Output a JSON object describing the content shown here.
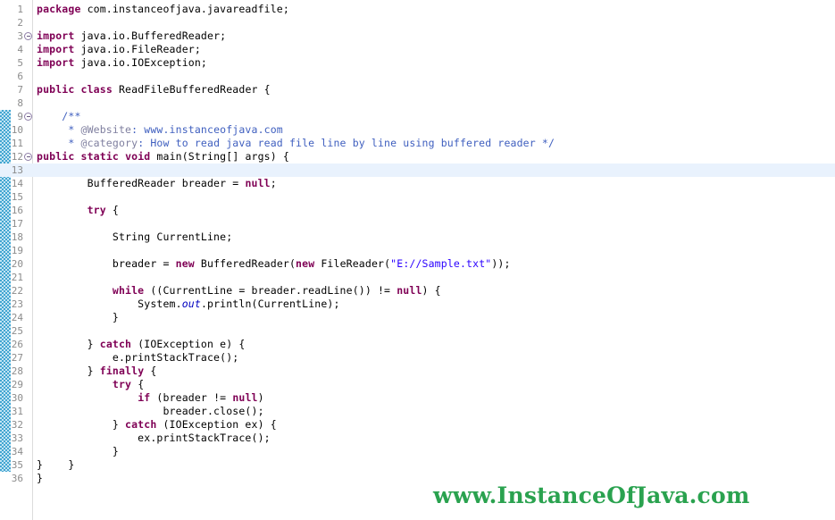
{
  "app": {
    "name": "eclipse-java-editor",
    "file_language": "Java"
  },
  "theme": {
    "background": "#ffffff",
    "line_number_color": "#8c8c8c",
    "current_line_highlight": "#e9f2fd",
    "keyword_color": "#7f0055",
    "string_color": "#2a00ff",
    "javadoc_color": "#3f5fbf",
    "javadoc_tag_color": "#7f7f9f",
    "static_field_color": "#0000c0",
    "change_bar_color": "#2196c9",
    "watermark_color": "#2aa24f"
  },
  "editor": {
    "current_line": 13,
    "change_bar_from_line": 9,
    "change_bar_to_line": 35,
    "fold_markers_on_lines": [
      3,
      9,
      12
    ],
    "lines": [
      {
        "n": 1,
        "tokens": [
          {
            "t": "kw",
            "v": "package"
          },
          {
            "t": "plain",
            "v": " com.instanceofjava.javareadfile;"
          }
        ]
      },
      {
        "n": 2,
        "tokens": []
      },
      {
        "n": 3,
        "tokens": [
          {
            "t": "kw",
            "v": "import"
          },
          {
            "t": "plain",
            "v": " java.io.BufferedReader;"
          }
        ]
      },
      {
        "n": 4,
        "tokens": [
          {
            "t": "kw",
            "v": "import"
          },
          {
            "t": "plain",
            "v": " java.io.FileReader;"
          }
        ]
      },
      {
        "n": 5,
        "tokens": [
          {
            "t": "kw",
            "v": "import"
          },
          {
            "t": "plain",
            "v": " java.io.IOException;"
          }
        ]
      },
      {
        "n": 6,
        "tokens": []
      },
      {
        "n": 7,
        "tokens": [
          {
            "t": "kw",
            "v": "public"
          },
          {
            "t": "plain",
            "v": " "
          },
          {
            "t": "kw",
            "v": "class"
          },
          {
            "t": "plain",
            "v": " ReadFileBufferedReader {"
          }
        ]
      },
      {
        "n": 8,
        "tokens": []
      },
      {
        "n": 9,
        "tokens": [
          {
            "t": "cmt",
            "v": "    /**"
          }
        ]
      },
      {
        "n": 10,
        "tokens": [
          {
            "t": "cmt",
            "v": "     * "
          },
          {
            "t": "cmtt",
            "v": "@Website"
          },
          {
            "t": "cmt",
            "v": ": www.instanceofjava.com"
          }
        ]
      },
      {
        "n": 11,
        "tokens": [
          {
            "t": "cmt",
            "v": "     * "
          },
          {
            "t": "cmtt",
            "v": "@category"
          },
          {
            "t": "cmt",
            "v": ": How to read java read file line by line using buffered reader */"
          }
        ]
      },
      {
        "n": 12,
        "tokens": [
          {
            "t": "kw",
            "v": "public"
          },
          {
            "t": "plain",
            "v": " "
          },
          {
            "t": "kw",
            "v": "static"
          },
          {
            "t": "plain",
            "v": " "
          },
          {
            "t": "kw",
            "v": "void"
          },
          {
            "t": "plain",
            "v": " main(String[] args) {"
          }
        ]
      },
      {
        "n": 13,
        "tokens": []
      },
      {
        "n": 14,
        "tokens": [
          {
            "t": "plain",
            "v": "        BufferedReader breader = "
          },
          {
            "t": "kw",
            "v": "null"
          },
          {
            "t": "plain",
            "v": ";"
          }
        ]
      },
      {
        "n": 15,
        "tokens": []
      },
      {
        "n": 16,
        "tokens": [
          {
            "t": "plain",
            "v": "        "
          },
          {
            "t": "kw",
            "v": "try"
          },
          {
            "t": "plain",
            "v": " {"
          }
        ]
      },
      {
        "n": 17,
        "tokens": []
      },
      {
        "n": 18,
        "tokens": [
          {
            "t": "plain",
            "v": "            String CurrentLine;"
          }
        ]
      },
      {
        "n": 19,
        "tokens": []
      },
      {
        "n": 20,
        "tokens": [
          {
            "t": "plain",
            "v": "            breader = "
          },
          {
            "t": "kw",
            "v": "new"
          },
          {
            "t": "plain",
            "v": " BufferedReader("
          },
          {
            "t": "kw",
            "v": "new"
          },
          {
            "t": "plain",
            "v": " FileReader("
          },
          {
            "t": "str",
            "v": "\"E://Sample.txt\""
          },
          {
            "t": "plain",
            "v": "));"
          }
        ]
      },
      {
        "n": 21,
        "tokens": []
      },
      {
        "n": 22,
        "tokens": [
          {
            "t": "plain",
            "v": "            "
          },
          {
            "t": "kw",
            "v": "while"
          },
          {
            "t": "plain",
            "v": " ((CurrentLine = breader.readLine()) != "
          },
          {
            "t": "kw",
            "v": "null"
          },
          {
            "t": "plain",
            "v": ") {"
          }
        ]
      },
      {
        "n": 23,
        "tokens": [
          {
            "t": "plain",
            "v": "                System."
          },
          {
            "t": "sfld",
            "v": "out"
          },
          {
            "t": "plain",
            "v": ".println(CurrentLine);"
          }
        ]
      },
      {
        "n": 24,
        "tokens": [
          {
            "t": "plain",
            "v": "            }"
          }
        ]
      },
      {
        "n": 25,
        "tokens": []
      },
      {
        "n": 26,
        "tokens": [
          {
            "t": "plain",
            "v": "        } "
          },
          {
            "t": "kw",
            "v": "catch"
          },
          {
            "t": "plain",
            "v": " (IOException e) {"
          }
        ]
      },
      {
        "n": 27,
        "tokens": [
          {
            "t": "plain",
            "v": "            e.printStackTrace();"
          }
        ]
      },
      {
        "n": 28,
        "tokens": [
          {
            "t": "plain",
            "v": "        } "
          },
          {
            "t": "kw",
            "v": "finally"
          },
          {
            "t": "plain",
            "v": " {"
          }
        ]
      },
      {
        "n": 29,
        "tokens": [
          {
            "t": "plain",
            "v": "            "
          },
          {
            "t": "kw",
            "v": "try"
          },
          {
            "t": "plain",
            "v": " {"
          }
        ]
      },
      {
        "n": 30,
        "tokens": [
          {
            "t": "plain",
            "v": "                "
          },
          {
            "t": "kw",
            "v": "if"
          },
          {
            "t": "plain",
            "v": " (breader != "
          },
          {
            "t": "kw",
            "v": "null"
          },
          {
            "t": "plain",
            "v": ")"
          }
        ]
      },
      {
        "n": 31,
        "tokens": [
          {
            "t": "plain",
            "v": "                    breader.close();"
          }
        ]
      },
      {
        "n": 32,
        "tokens": [
          {
            "t": "plain",
            "v": "            } "
          },
          {
            "t": "kw",
            "v": "catch"
          },
          {
            "t": "plain",
            "v": " (IOException ex) {"
          }
        ]
      },
      {
        "n": 33,
        "tokens": [
          {
            "t": "plain",
            "v": "                ex.printStackTrace();"
          }
        ]
      },
      {
        "n": 34,
        "tokens": [
          {
            "t": "plain",
            "v": "            }"
          }
        ]
      },
      {
        "n": 35,
        "tokens": [
          {
            "t": "plain",
            "v": "}    }"
          }
        ]
      },
      {
        "n": 36,
        "tokens": [
          {
            "t": "plain",
            "v": "}"
          }
        ]
      }
    ]
  },
  "watermark": {
    "text": "www.InstanceOfJava.com"
  }
}
